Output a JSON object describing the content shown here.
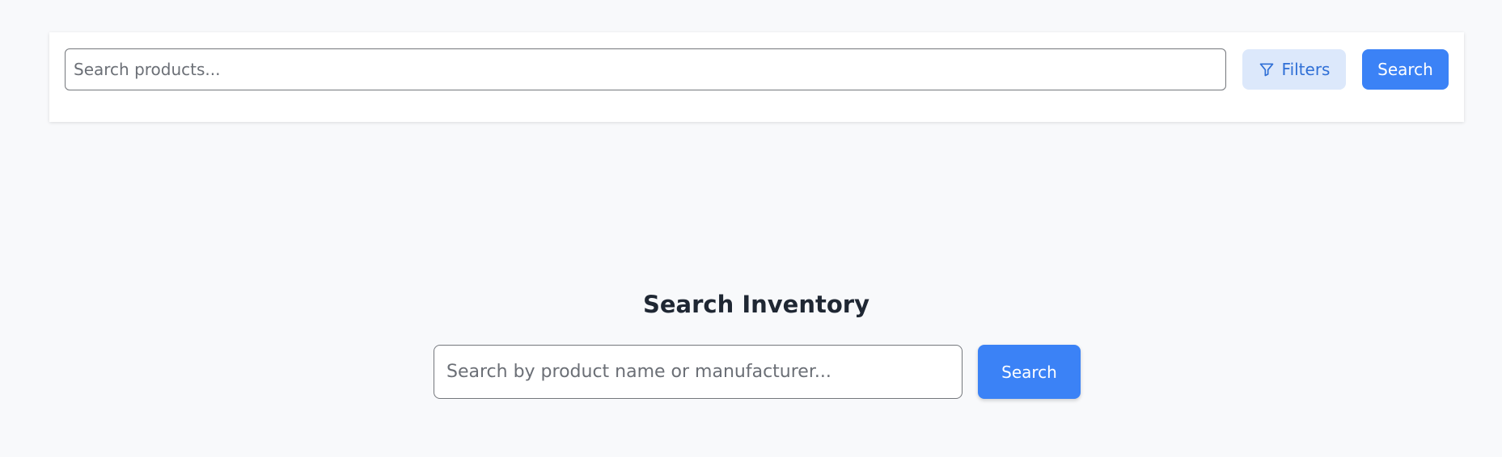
{
  "colors": {
    "background": "#f8f9fb",
    "accent": "#3b82f6",
    "filters_bg": "#dce8fb",
    "filters_text": "#2f6fd6",
    "title": "#1f2733"
  },
  "topbar": {
    "search_placeholder": "Search products...",
    "search_value": "",
    "filters_icon": "filter-funnel-icon",
    "filters_label": "Filters",
    "search_button_label": "Search"
  },
  "main": {
    "title": "Search Inventory",
    "search_placeholder": "Search by product name or manufacturer...",
    "search_value": "",
    "search_button_label": "Search"
  }
}
